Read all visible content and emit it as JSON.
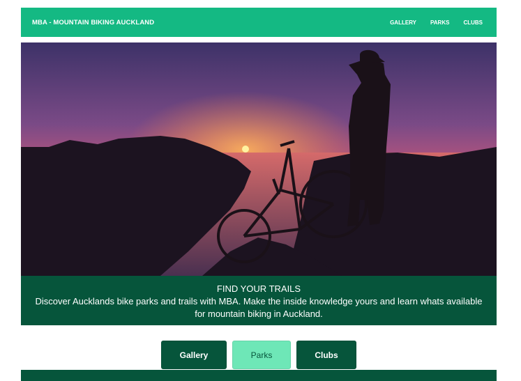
{
  "navbar": {
    "brand": "MBA - MOUNTAIN BIKING AUCKLAND",
    "links": [
      "GALLERY",
      "PARKS",
      "CLUBS"
    ]
  },
  "hero": {
    "image": "sunset-mountain-biker-silhouette"
  },
  "caption": {
    "title": "FIND YOUR TRAILS",
    "text": "Discover Aucklands bike parks and trails with MBA. Make the inside knowledge yours and learn whats available for mountain biking in Auckland."
  },
  "buttons": [
    "Gallery",
    "Parks",
    "Clubs"
  ],
  "colors": {
    "navbar": "#14b983",
    "dark_green": "#06553b",
    "light_green": "#6ee7b7"
  }
}
